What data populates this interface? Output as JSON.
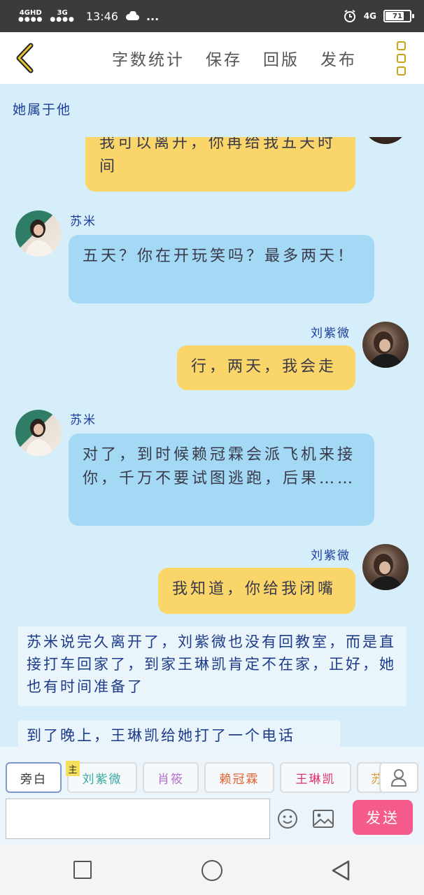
{
  "status_bar": {
    "signal1": "4GHD",
    "signal2": "3G",
    "time": "13:46",
    "more": "...",
    "network": "4G",
    "battery": "71"
  },
  "top_bar": {
    "word_count": "字数统计",
    "save": "保存",
    "return_version": "回版",
    "publish": "发布"
  },
  "chapter_title": "她属于他",
  "messages": [
    {
      "side": "right",
      "color": "yellow",
      "text": "我可以离开，你再给我五天时间"
    },
    {
      "side": "left",
      "speaker": "苏米",
      "color": "blue",
      "text": "五天？你在开玩笑吗？最多两天！"
    },
    {
      "side": "right",
      "speaker": "刘紫微",
      "color": "yellow",
      "text": "行，两天，我会走"
    },
    {
      "side": "left",
      "speaker": "苏米",
      "color": "blue",
      "text": "对了，到时候赖冠霖会派飞机来接你，千万不要试图逃跑，后果……"
    },
    {
      "side": "right",
      "speaker": "刘紫微",
      "color": "yellow",
      "text": "我知道，你给我闭嘴"
    }
  ],
  "narrations": [
    "苏米说完久离开了，刘紫微也没有回教室，而是直接打车回家了，到家王琳凯肯定不在家，正好，她也有时间准备了",
    "到了晚上，王琳凯给她打了一个电话"
  ],
  "characters": {
    "narrator": "旁白",
    "main_badge": "主",
    "list": [
      {
        "name": "刘紫微",
        "color": "#36a9a0"
      },
      {
        "name": "肖筱",
        "color": "#b36fc9"
      },
      {
        "name": "赖冠霖",
        "color": "#e0622e"
      },
      {
        "name": "王琳凯",
        "color": "#e0306a"
      },
      {
        "name": "苏",
        "color": "#e09a3a"
      }
    ]
  },
  "composer": {
    "input_value": "",
    "send": "发送"
  },
  "colors": {
    "background": "#d6eef9",
    "bubble_blue": "#a3d9f5",
    "bubble_yellow": "#fad56a",
    "send": "#f45a8a",
    "accent_text": "#1b3c9a"
  }
}
